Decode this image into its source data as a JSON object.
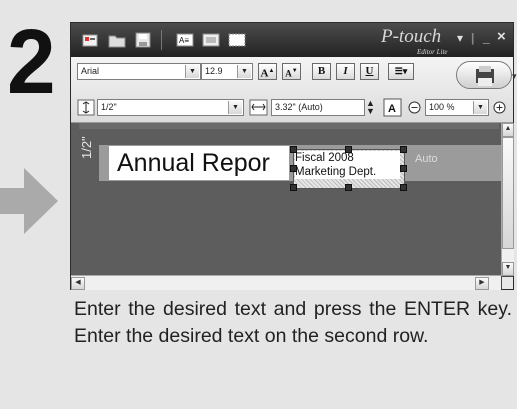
{
  "step_number": "2",
  "app": {
    "logo": "P-touch",
    "logo_sub": "Editor Lite",
    "controls": {
      "dropdown": "▾",
      "minimize": "_",
      "close": "×",
      "separator": "|"
    }
  },
  "toolbar": {
    "font_name": "Arial",
    "font_size": "12.9",
    "grow_font": "A",
    "shrink_font": "A",
    "bold": "B",
    "italic": "I",
    "underline": "U",
    "tape_width": "1/2\"",
    "tape_length": "3.32\" (Auto)",
    "zoom": "100 %"
  },
  "canvas": {
    "tape_size_label": "1/2\"",
    "line1": "Annual Repor",
    "sel_line1": "Fiscal 2008",
    "sel_line2": "Marketing Dept.",
    "length_mode": "Auto"
  },
  "caption": "Enter the desired text and press the ENTER key. Enter the desired text on the second row."
}
